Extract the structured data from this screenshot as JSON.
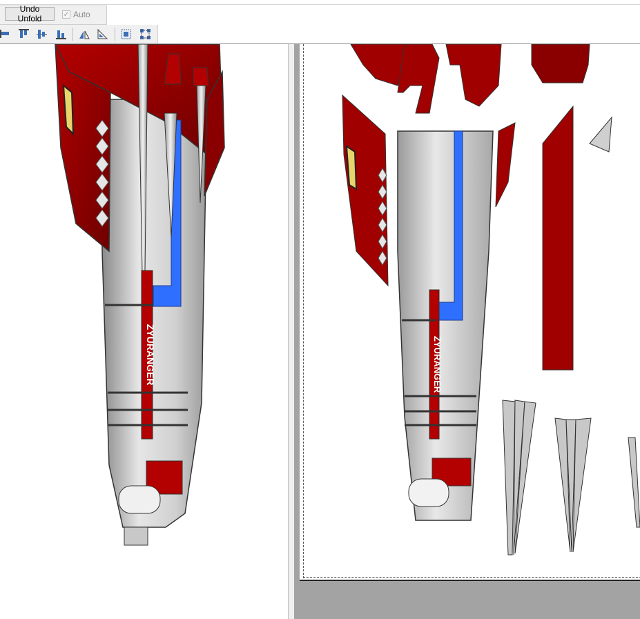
{
  "toolbar": {
    "undo_unfold_label": "Undo Unfold",
    "auto_label": "Auto",
    "auto_checked": true,
    "tools": [
      "align-left-icon",
      "align-top-icon",
      "align-center-icon",
      "align-bottom-icon",
      "mirror-horizontal-icon",
      "mirror-vertical-icon",
      "group-icon",
      "ungroup-icon"
    ]
  },
  "model": {
    "logo_text": "ZYURANGER"
  },
  "colors": {
    "red": "#a00000",
    "dark_red": "#6e0000",
    "grey": "#c8c8c8",
    "blue": "#2f6fff",
    "yellow": "#e8d46a"
  }
}
